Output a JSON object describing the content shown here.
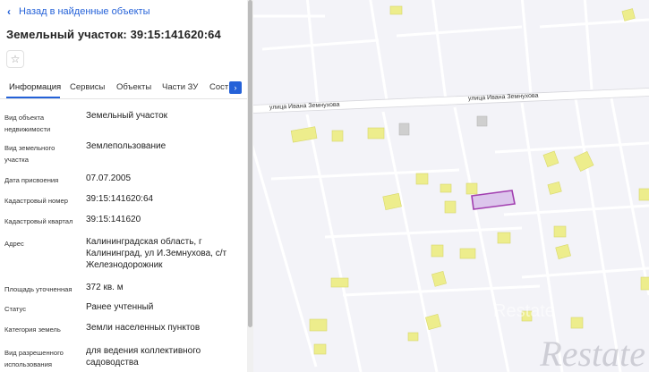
{
  "nav": {
    "back_label": "Назад в найденные объекты"
  },
  "object": {
    "title": "Земельный участок: 39:15:141620:64"
  },
  "tabs": [
    {
      "label": "Информация",
      "active": true
    },
    {
      "label": "Сервисы"
    },
    {
      "label": "Объекты"
    },
    {
      "label": "Части ЗУ"
    },
    {
      "label": "Сост"
    }
  ],
  "info": [
    {
      "label": "Вид объекта недвижимости",
      "value": "Земельный участок"
    },
    {
      "label": "Вид земельного участка",
      "value": "Землепользование"
    },
    {
      "label": "Дата присвоения",
      "value": "07.07.2005"
    },
    {
      "label": "Кадастровый номер",
      "value": "39:15:141620:64"
    },
    {
      "label": "Кадастровый квартал",
      "value": "39:15:141620"
    },
    {
      "label": "Адрес",
      "value": "Калининградская область, г Калининград, ул И.Земнухова, с/т Железнодорожник"
    },
    {
      "label": "Площадь уточненная",
      "value": "372 кв. м"
    },
    {
      "label": "Статус",
      "value": "Ранее учтенный"
    },
    {
      "label": "Категория земель",
      "value": "Земли населенных пунктов"
    },
    {
      "label": "Вид разрешенного использования",
      "value": "для ведения коллективного садоводства"
    }
  ],
  "map": {
    "street_labels": [
      "улица Ивана Земнухова",
      "улица Ивана Земнухова"
    ],
    "colors": {
      "building": "#eded8c",
      "building_gray": "#cfcfcf",
      "parcel_fill": "#dcc6ec",
      "parcel_stroke": "#a23fb0",
      "road": "#ffffff",
      "background": "#f3f3f8"
    },
    "watermark": "Restate"
  },
  "icons": {
    "back": "chevron-left-icon",
    "favorite": "star-outline-icon",
    "tabs_next": "chevron-right-icon"
  }
}
